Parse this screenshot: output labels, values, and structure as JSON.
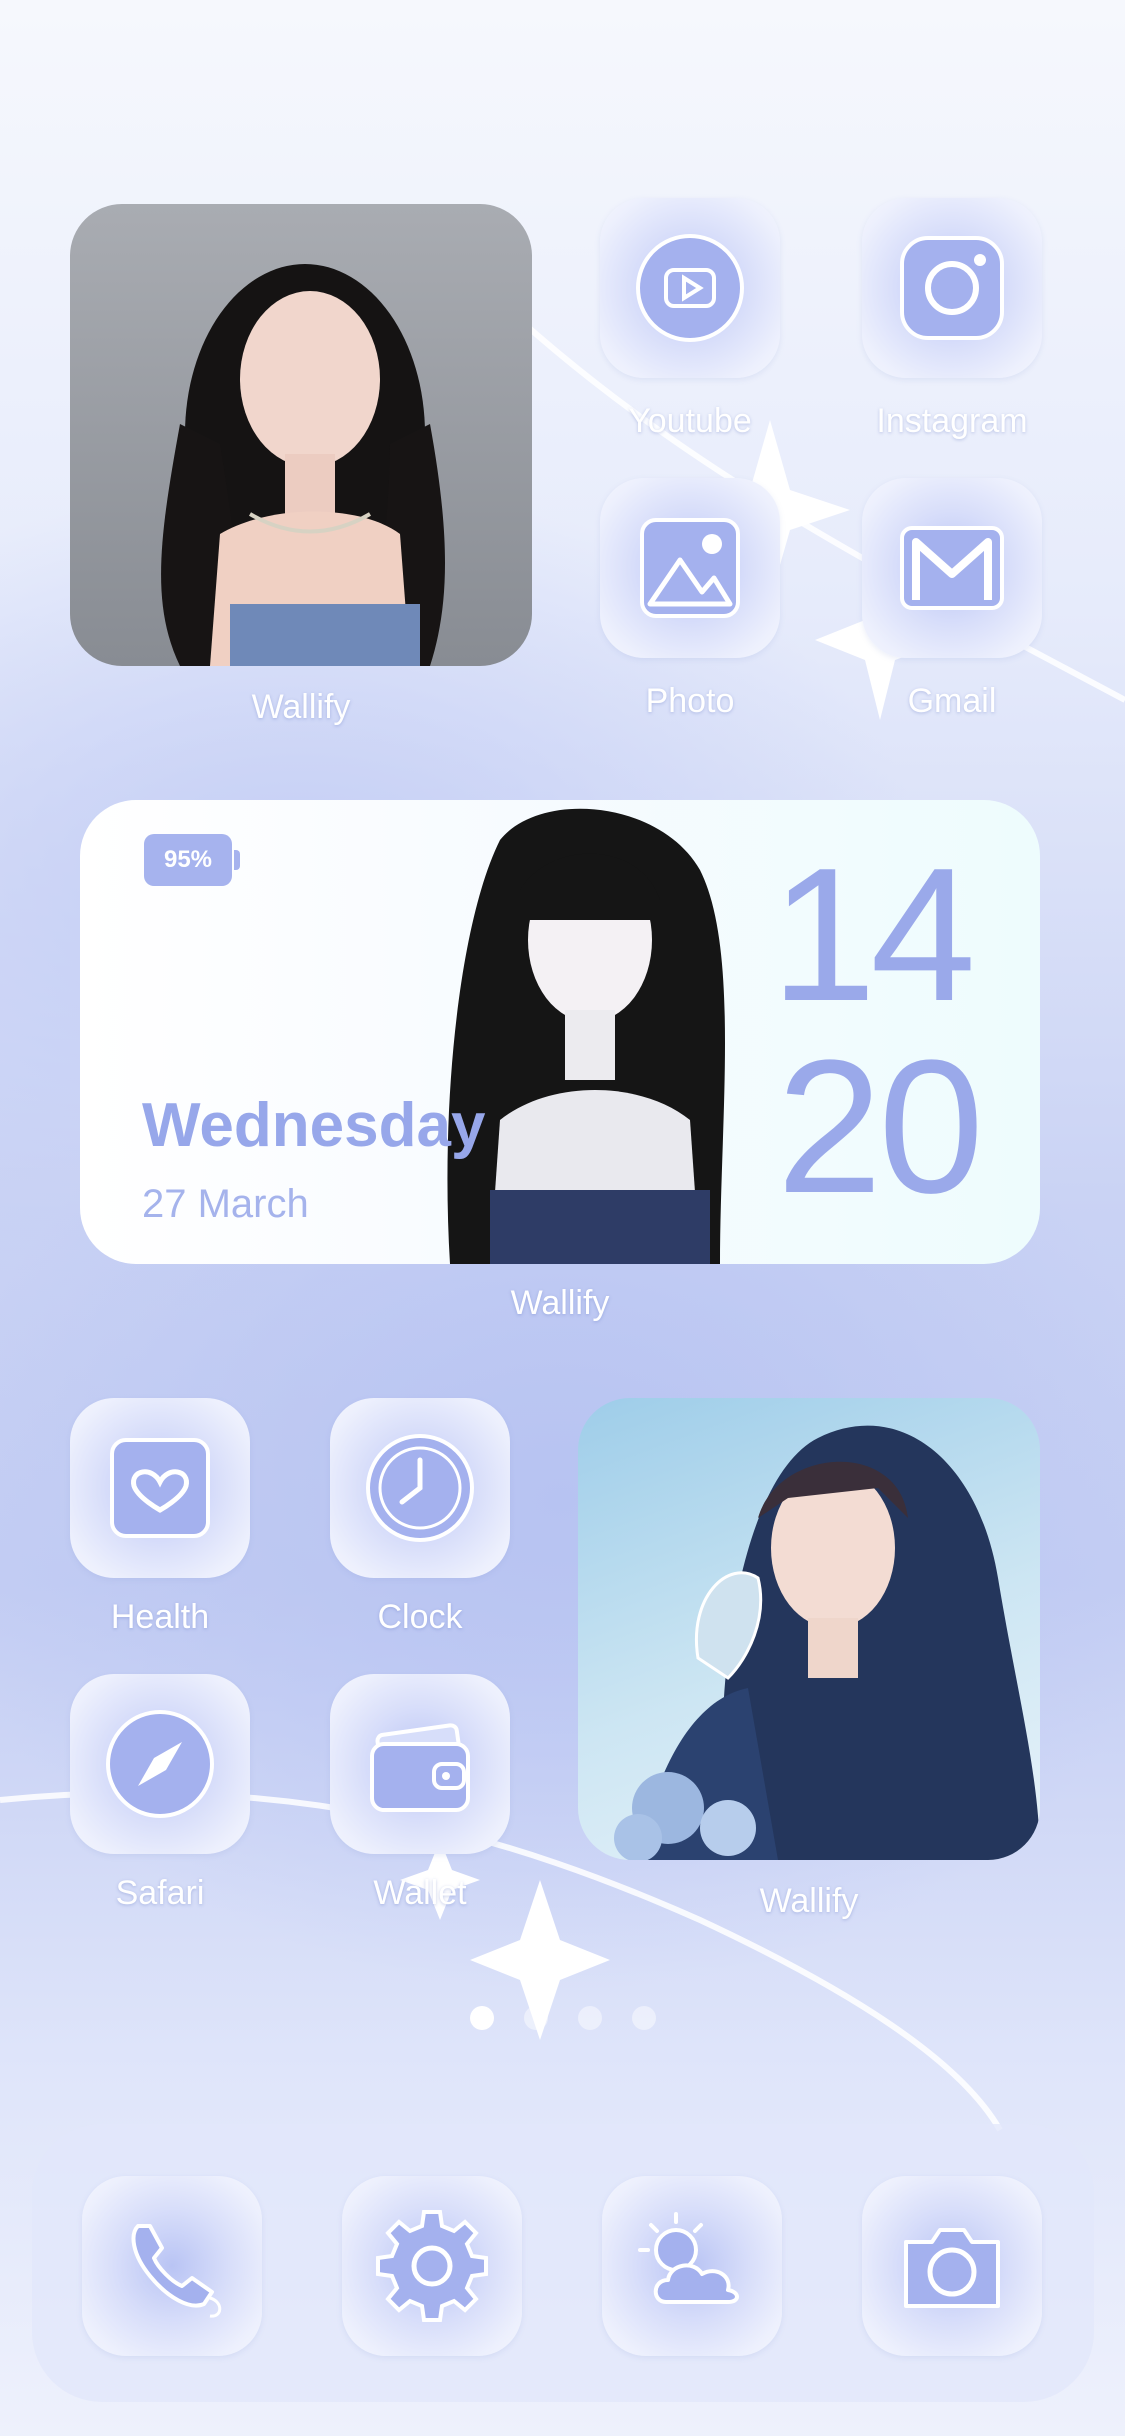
{
  "widgets": {
    "top_photo_label": "Wallify",
    "calendar": {
      "battery": "95%",
      "day": "Wednesday",
      "date": "27 March",
      "hour": "14",
      "minute": "20",
      "label": "Wallify"
    },
    "bottom_photo_label": "Wallify"
  },
  "apps": {
    "youtube": "Youtube",
    "instagram": "Instagram",
    "photo": "Photo",
    "gmail": "Gmail",
    "health": "Health",
    "clock": "Clock",
    "safari": "Safari",
    "wallet": "Wallet"
  },
  "page_indicator": {
    "pages": 4,
    "current": 1
  },
  "dock": {
    "icons": [
      "phone-icon",
      "settings-icon",
      "weather-icon",
      "camera-icon"
    ]
  },
  "colors": {
    "accent": "#9aa9ea",
    "tile": "#b9c4f4",
    "label": "#ffffff"
  }
}
